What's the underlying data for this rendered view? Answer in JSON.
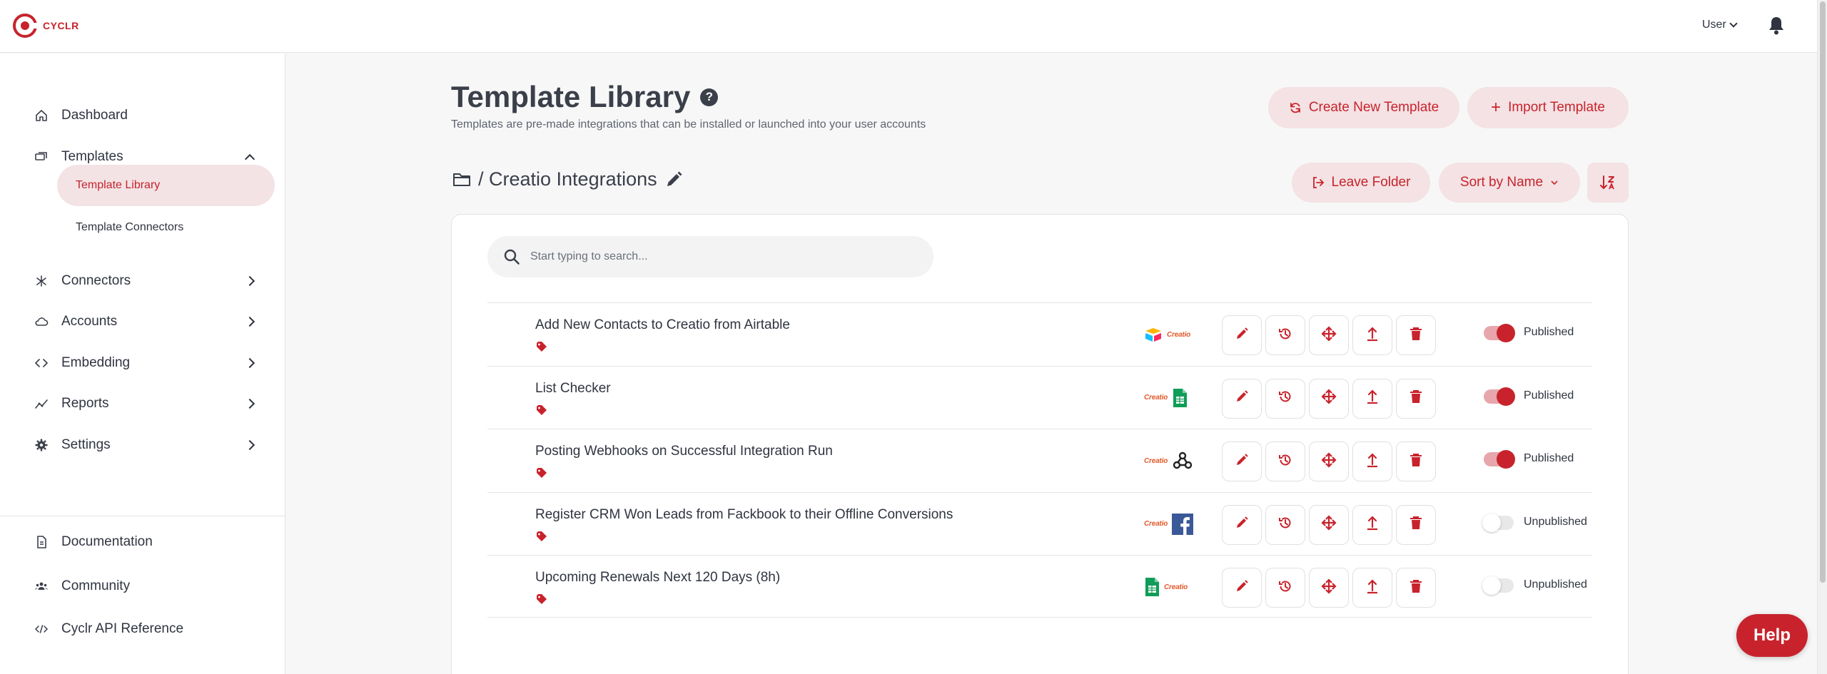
{
  "brand": {
    "name": "CYCLR",
    "color": "#c8232c"
  },
  "topbar": {
    "user_label": "User"
  },
  "sidebar": {
    "items": [
      {
        "label": "Dashboard",
        "icon": "home-icon"
      },
      {
        "label": "Templates",
        "icon": "templates-icon",
        "expanded": true
      },
      {
        "label": "Connectors",
        "icon": "connectors-icon"
      },
      {
        "label": "Accounts",
        "icon": "cloud-icon"
      },
      {
        "label": "Embedding",
        "icon": "code-icon"
      },
      {
        "label": "Reports",
        "icon": "reports-icon"
      },
      {
        "label": "Settings",
        "icon": "gear-icon"
      }
    ],
    "sub_items": [
      {
        "label": "Template Library",
        "active": true
      },
      {
        "label": "Template Connectors",
        "active": false
      }
    ],
    "bottom": [
      {
        "label": "Documentation",
        "icon": "document-icon"
      },
      {
        "label": "Community",
        "icon": "people-icon"
      },
      {
        "label": "Cyclr API Reference",
        "icon": "api-code-icon"
      }
    ]
  },
  "header": {
    "title": "Template Library",
    "subtitle": "Templates are pre-made integrations that can be installed or launched into your user accounts",
    "create_label": "Create New Template",
    "import_label": "Import Template"
  },
  "folder": {
    "breadcrumb": "/ Creatio Integrations",
    "leave_label": "Leave Folder",
    "sort_label": "Sort by Name"
  },
  "search": {
    "placeholder": "Start typing to search...",
    "value": ""
  },
  "templates": [
    {
      "title": "Add New Contacts to Creatio from Airtable",
      "logos": [
        "airtable",
        "creatio"
      ],
      "status": "Published",
      "published": true
    },
    {
      "title": "List Checker",
      "logos": [
        "creatio",
        "google-sheets"
      ],
      "status": "Published",
      "published": true
    },
    {
      "title": "Posting Webhooks on Successful Integration Run",
      "logos": [
        "creatio",
        "webhook"
      ],
      "status": "Published",
      "published": true
    },
    {
      "title": "Register CRM Won Leads from Fackbook to their Offline Conversions",
      "logos": [
        "creatio",
        "facebook"
      ],
      "status": "Unpublished",
      "published": false
    },
    {
      "title": "Upcoming Renewals Next 120 Days (8h)",
      "logos": [
        "google-sheets",
        "creatio"
      ],
      "status": "Unpublished",
      "published": false
    }
  ],
  "logo_text": {
    "creatio": "Creatio"
  },
  "help_label": "Help"
}
